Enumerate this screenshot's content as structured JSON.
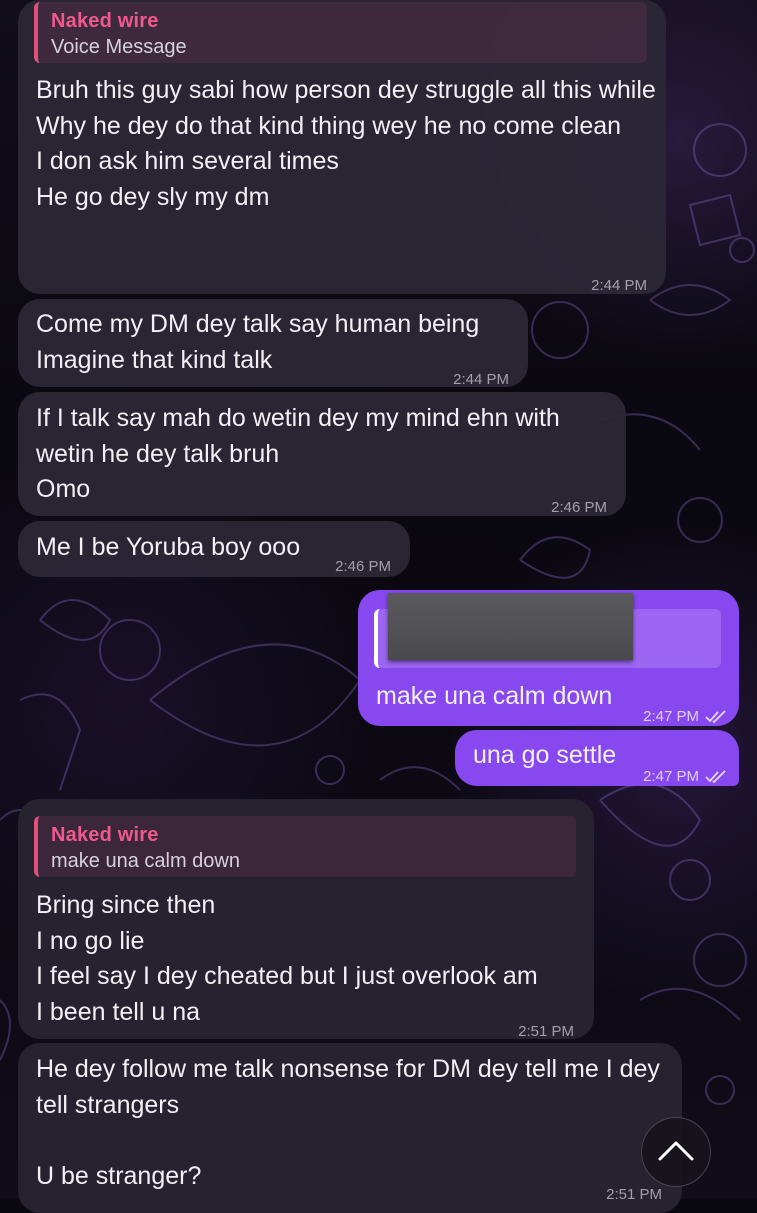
{
  "messages": [
    {
      "reply": {
        "name": "Naked wire",
        "text": "Voice Message"
      },
      "text": "Bruh this guy sabi how person dey struggle all this while\nWhy he dey do that kind thing wey he no come clean\nI don ask him several times\nHe go dey sly my dm",
      "time": "2:44 PM"
    },
    {
      "text": "Come my DM dey talk say human being\nImagine that kind talk",
      "time": "2:44 PM"
    },
    {
      "text": "If I talk say mah do wetin dey my mind ehn with wetin he dey talk bruh\nOmo",
      "time": "2:46 PM"
    },
    {
      "text": "Me I be Yoruba boy ooo",
      "time": "2:46 PM"
    },
    {
      "reply_redacted": true,
      "text": "make una calm down",
      "time": "2:47 PM",
      "status": "read"
    },
    {
      "text": "una go settle",
      "time": "2:47 PM",
      "status": "read"
    },
    {
      "reply": {
        "name": "Naked wire",
        "text": "make una calm down"
      },
      "text": "Bring since then\nI no go lie\nI feel say I dey cheated but I just overlook am\nI been tell u na",
      "time": "2:51 PM"
    },
    {
      "text": "He dey follow me talk nonsense for DM dey tell me I dey tell strangers\n\nU be stranger?",
      "time": "2:51 PM"
    }
  ],
  "colors": {
    "incoming_bubble": "#2c2836",
    "outgoing_bubble": "#8848f0",
    "reply_accent": "#ee5a8d"
  },
  "icons": {
    "read_status": "double-check-icon",
    "scroll_down": "chevron-up-icon"
  }
}
